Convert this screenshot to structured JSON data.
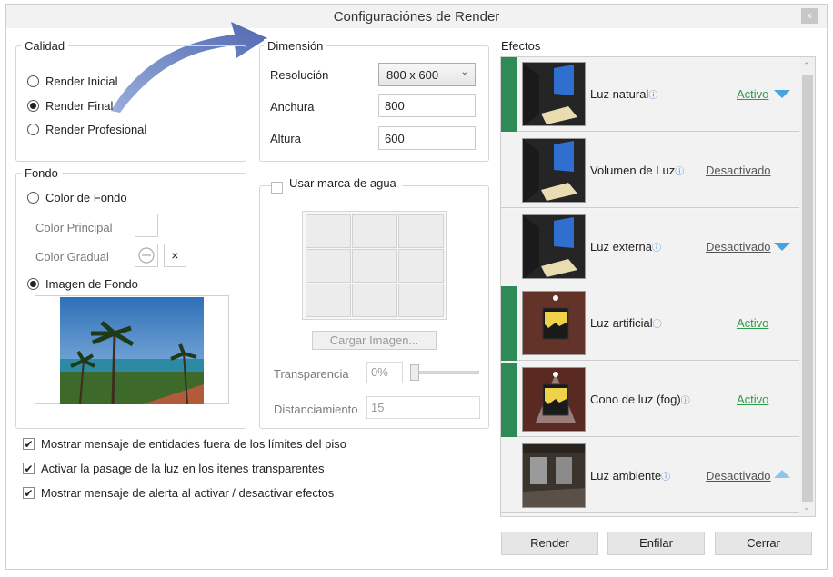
{
  "window": {
    "title": "Configuraciónes de Render",
    "close_label": "x"
  },
  "calidad": {
    "legend": "Calidad",
    "options": [
      {
        "label": "Render Inicial",
        "selected": false
      },
      {
        "label": "Render Final",
        "selected": true
      },
      {
        "label": "Render Profesional",
        "selected": false
      }
    ]
  },
  "dimension": {
    "legend": "Dimensión",
    "resolucion_label": "Resolución",
    "resolucion_value": "800 x 600",
    "anchura_label": "Anchura",
    "anchura_value": "800",
    "altura_label": "Altura",
    "altura_value": "600"
  },
  "fondo": {
    "legend": "Fondo",
    "color_fondo_label": "Color de Fondo",
    "color_principal_label": "Color Principal",
    "color_gradual_label": "Color Gradual",
    "clear_label": "×",
    "imagen_fondo_label": "Imagen de Fondo",
    "color_fondo_selected": false,
    "imagen_fondo_selected": true
  },
  "watermark": {
    "legend": "Usar marca de agua",
    "checked": false,
    "cargar_label": "Cargar Imagen...",
    "transparencia_label": "Transparencia",
    "transparencia_value": "0%",
    "transparencia_level": 0,
    "distanciamiento_label": "Distanciamiento",
    "distanciamiento_value": "15"
  },
  "options": [
    {
      "label": "Mostrar mensaje de entidades fuera de los límites del piso",
      "checked": true
    },
    {
      "label": "Activar la pasage de la luz en los itenes transparentes",
      "checked": true
    },
    {
      "label": "Mostrar mensaje de alerta al activar / desactivar efectos",
      "checked": true
    }
  ],
  "efectos": {
    "title": "Efectos",
    "items": [
      {
        "name": "Luz natural",
        "status": "Activo",
        "active": true,
        "arrow": "down"
      },
      {
        "name": "Volumen de Luz",
        "status": "Desactivado",
        "active": false,
        "arrow": "none"
      },
      {
        "name": "Luz externa",
        "status": "Desactivado",
        "active": false,
        "arrow": "down"
      },
      {
        "name": "Luz artificial",
        "status": "Activo",
        "active": true,
        "arrow": "none"
      },
      {
        "name": "Cono de luz (fog)",
        "status": "Activo",
        "active": true,
        "arrow": "none"
      },
      {
        "name": "Luz ambiente",
        "status": "Desactivado",
        "active": false,
        "arrow": "up"
      }
    ],
    "info_glyph": "ⓘ"
  },
  "buttons": {
    "render": "Render",
    "enfilar": "Enfilar",
    "cerrar": "Cerrar"
  },
  "colors": {
    "active_bar": "#2e8b57",
    "active_text": "#2f9a4a",
    "accent_arrow": "#4aa3e0"
  }
}
